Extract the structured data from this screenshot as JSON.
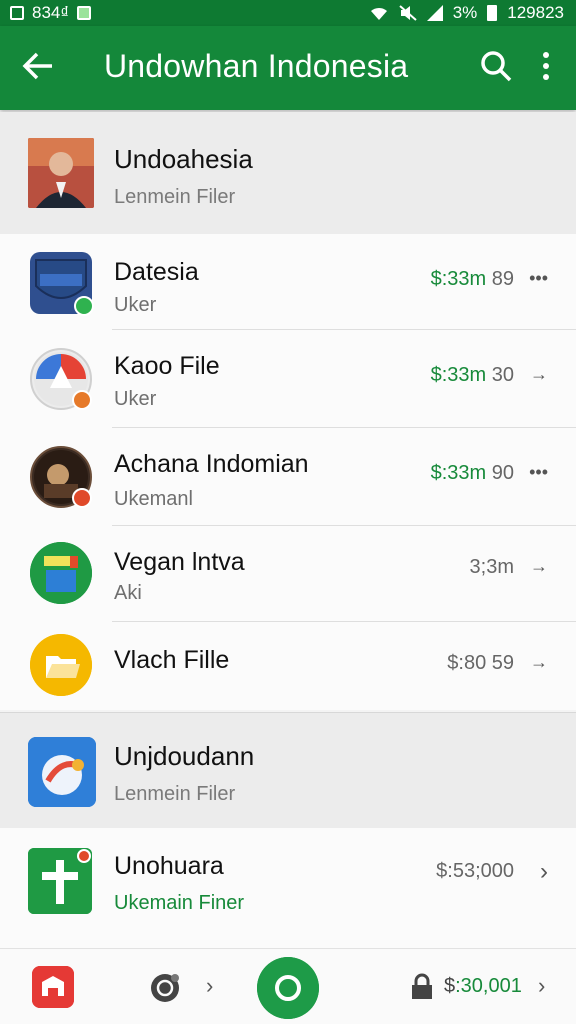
{
  "status_bar": {
    "left_text": "834₫",
    "battery_text": "3%",
    "clock_text": "129823"
  },
  "app_bar": {
    "title": "Undowhan Indonesia",
    "back_icon": "arrow-left-icon",
    "search_icon": "search-icon",
    "more_icon": "more-vert-icon"
  },
  "section1": {
    "title": "Undoahesia",
    "subtitle": "Lenmein Filer"
  },
  "rows": [
    {
      "name": "Datesia",
      "sub": "Uker",
      "price": "$:33m",
      "price_tail": "89",
      "action": "•••",
      "icon_color": "#2f4f8f",
      "badge_color": "#2fb24f",
      "price_style": "green"
    },
    {
      "name": "Kaoo File",
      "sub": "Uker",
      "price": "$:33m",
      "price_tail": "30",
      "action": "→",
      "icon_color": "#e9e9e9",
      "badge_color": "#e67a2a",
      "price_style": "green"
    },
    {
      "name": "Achana Indomian",
      "sub": "Ukemanl",
      "price": "$:33m",
      "price_tail": "90",
      "action": "•••",
      "icon_color": "#3b2b22",
      "badge_color": "#e04a2a",
      "price_style": "green"
    },
    {
      "name": "Vegan lntva",
      "sub": "Aki",
      "price": "3;3m",
      "price_tail": "",
      "action": "→",
      "icon_color": "#1f9a44",
      "badge_color": "",
      "price_style": "grey"
    },
    {
      "name": "Vlach Fille",
      "sub": "",
      "price": "$:80 59",
      "price_tail": "",
      "action": "→",
      "icon_color": "#f5b800",
      "badge_color": "",
      "price_style": "grey"
    }
  ],
  "section2": {
    "title": "Unjdoudann",
    "subtitle": "Lenmein Filer"
  },
  "row6": {
    "name": "Unohuara",
    "sub": "Ukemain Finer",
    "price": "$:53;000",
    "action": "›"
  },
  "bottom_bar": {
    "chevron1": "›",
    "price_prefix": "$",
    "price_rest": ":30,001",
    "chevron2": "›"
  },
  "colors": {
    "app_bar": "#14883a",
    "status_bar": "#0e7a32",
    "accent_green": "#178a3a"
  }
}
